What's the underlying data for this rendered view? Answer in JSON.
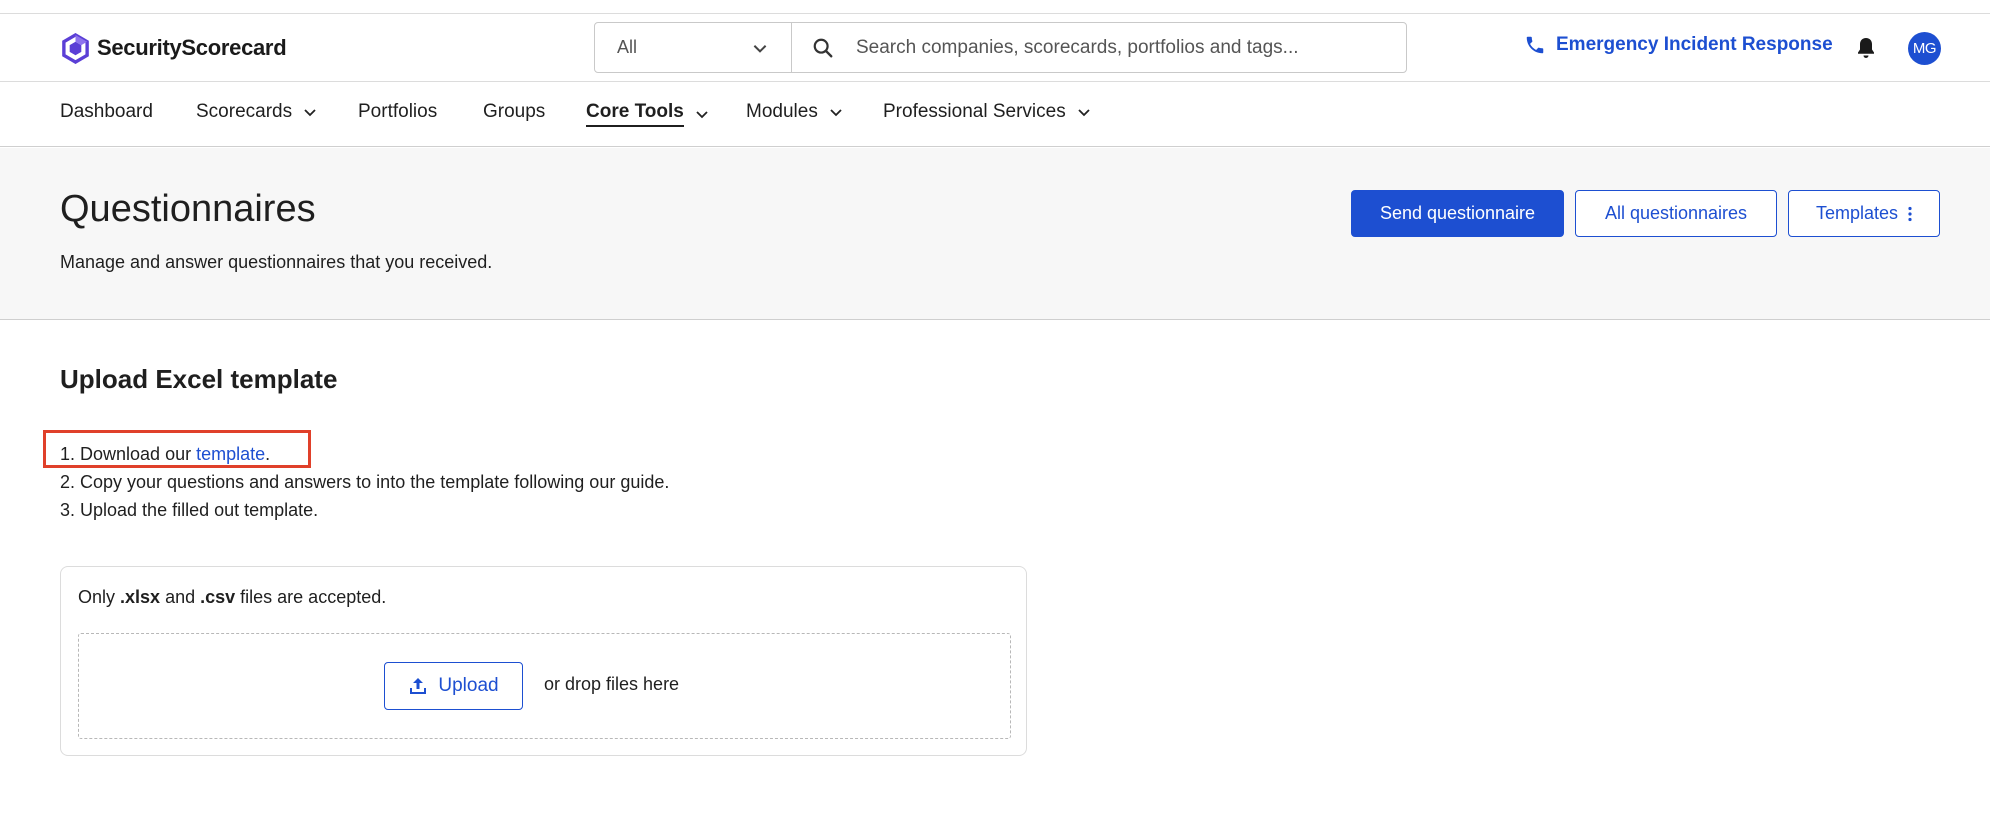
{
  "header": {
    "logo_text": "SecurityScorecard",
    "search_scope": "All",
    "search_placeholder": "Search companies, scorecards, portfolios and tags...",
    "emergency_label": "Emergency Incident Response",
    "avatar_initials": "MG"
  },
  "nav": {
    "items": [
      {
        "label": "Dashboard"
      },
      {
        "label": "Scorecards"
      },
      {
        "label": "Portfolios"
      },
      {
        "label": "Groups"
      },
      {
        "label": "Core Tools"
      },
      {
        "label": "Modules"
      },
      {
        "label": "Professional Services"
      }
    ],
    "active": "Core Tools"
  },
  "page": {
    "title": "Questionnaires",
    "subtitle": "Manage and answer questionnaires that you received.",
    "buttons": {
      "send": "Send questionnaire",
      "all": "All questionnaires",
      "templates": "Templates"
    }
  },
  "upload": {
    "section_title": "Upload Excel template",
    "step1_prefix": "1. Download our ",
    "step1_link": "template",
    "step1_suffix": ".",
    "step2": "2. Copy your questions and answers to into the template following our guide.",
    "step3": "3. Upload the filled out template.",
    "accepted_prefix": "Only ",
    "accepted_ext1": ".xlsx",
    "accepted_mid": " and ",
    "accepted_ext2": ".csv",
    "accepted_suffix": " files are accepted.",
    "upload_label": "Upload",
    "drop_text": "or drop files here"
  },
  "colors": {
    "accent": "#1d4fd1",
    "highlight": "#e0402a",
    "logo": "#5b3fd6"
  },
  "icons": {
    "search": "search-icon",
    "phone": "phone-icon",
    "bell": "bell-icon",
    "chevron": "chevron-down-icon",
    "kebab": "kebab-icon",
    "upload": "upload-icon"
  }
}
